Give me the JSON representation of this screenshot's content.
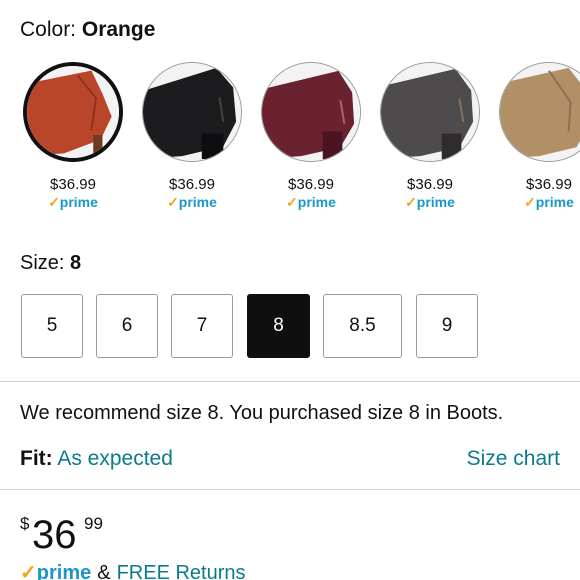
{
  "color": {
    "label": "Color:",
    "selected": "Orange",
    "swatches": [
      {
        "price": "$36.99",
        "prime": "prime",
        "tone": "#b9452a",
        "selected": true
      },
      {
        "price": "$36.99",
        "prime": "prime",
        "tone": "#1c1c1f",
        "selected": false
      },
      {
        "price": "$36.99",
        "prime": "prime",
        "tone": "#6a2231",
        "selected": false
      },
      {
        "price": "$36.99",
        "prime": "prime",
        "tone": "#4d4b4c",
        "selected": false
      },
      {
        "price": "$36.99",
        "prime": "prime",
        "tone": "#b19068",
        "selected": false
      }
    ]
  },
  "size": {
    "label": "Size:",
    "selected": "8",
    "options": [
      "5",
      "6",
      "7",
      "8",
      "8.5",
      "9"
    ]
  },
  "recommendation": "We recommend size 8. You purchased size 8 in Boots.",
  "fit": {
    "label": "Fit:",
    "value": "As expected",
    "size_chart": "Size chart"
  },
  "price": {
    "symbol": "$",
    "whole": "36",
    "fraction": "99"
  },
  "shipping": {
    "prime": "prime",
    "ampersand": "&",
    "returns": "FREE Returns"
  },
  "colors": {
    "link": "#0b7a8c",
    "prime_blue": "#1a98c8",
    "prime_check": "#f4a31c",
    "selected_dark": "#0f0f0f"
  }
}
